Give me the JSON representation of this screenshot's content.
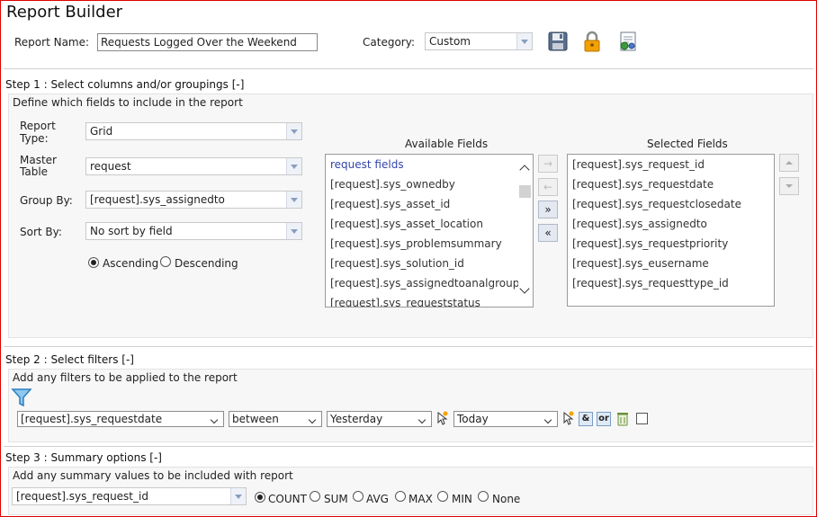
{
  "title": "Report Builder",
  "header": {
    "report_name_label": "Report Name:",
    "report_name_value": "Requests Logged Over the Weekend",
    "category_label": "Category:",
    "category_value": "Custom",
    "icons": [
      "save-icon",
      "lock-icon",
      "report-properties-icon"
    ]
  },
  "step1": {
    "heading": "Step 1 : Select columns and/or groupings [-]",
    "subheading": "Define which fields to include in the report",
    "report_type_label": "Report Type:",
    "report_type_value": "Grid",
    "master_table_label": "Master Table",
    "master_table_value": "request",
    "group_by_label": "Group By:",
    "group_by_value": "[request].sys_assignedto",
    "sort_by_label": "Sort By:",
    "sort_by_value": "No sort by field",
    "ascending_label": "Ascending",
    "descending_label": "Descending",
    "available_title": "Available Fields",
    "available_fields": [
      "request fields",
      "[request].sys_ownedby",
      "[request].sys_asset_id",
      "[request].sys_asset_location",
      "[request].sys_problemsummary",
      "[request].sys_solution_id",
      "[request].sys_assignedtoanalgroup",
      "[request].sys_requeststatus"
    ],
    "selected_title": "Selected Fields",
    "selected_fields": [
      "[request].sys_request_id",
      "[request].sys_requestdate",
      "[request].sys_requestclosedate",
      "[request].sys_assignedto",
      "[request].sys_requestpriority",
      "[request].sys_eusername",
      "[request].sys_requesttype_id"
    ],
    "move_buttons": [
      "→",
      "←",
      "»",
      "«"
    ]
  },
  "step2": {
    "heading": "Step 2 : Select filters [-]",
    "subheading": "Add any filters to be applied to the report",
    "field_value": "[request].sys_requestdate",
    "operator_value": "between",
    "from_value": "Yesterday",
    "to_value": "Today",
    "and_label": "&",
    "or_label": "or"
  },
  "step3": {
    "heading": "Step 3 : Summary options [-]",
    "subheading": "Add any summary values to be included with report",
    "field_value": "[request].sys_request_id",
    "options": [
      "COUNT",
      "SUM",
      "AVG",
      "MAX",
      "MIN",
      "None"
    ]
  },
  "colors": {
    "border": "#e00000",
    "link": "#3344aa"
  }
}
